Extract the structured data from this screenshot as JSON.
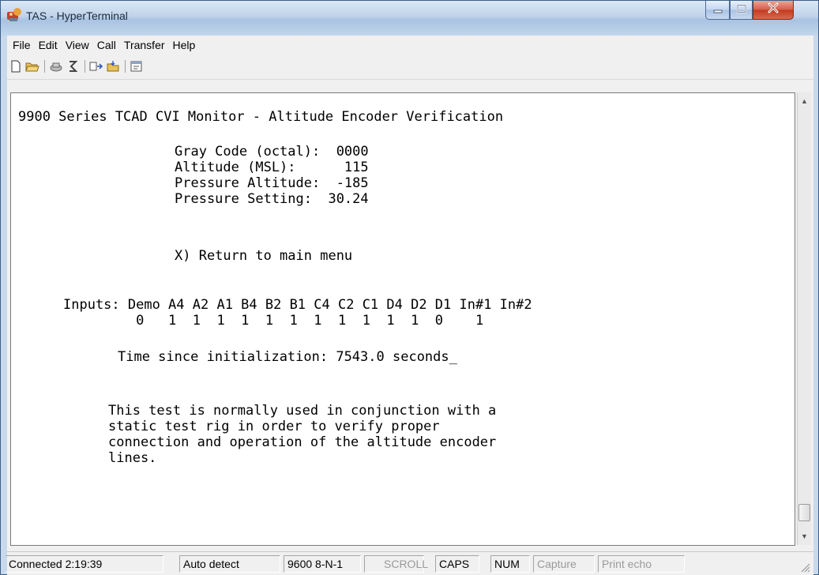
{
  "window": {
    "title": "TAS - HyperTerminal"
  },
  "menu": [
    "File",
    "Edit",
    "View",
    "Call",
    "Transfer",
    "Help"
  ],
  "toolbar": {
    "icons": [
      "new-connection-icon",
      "open-icon",
      "disconnect-icon",
      "dial-icon",
      "send-icon",
      "receive-icon",
      "properties-icon"
    ]
  },
  "terminal": {
    "header": "9900 Series TCAD CVI Monitor - Altitude Encoder Verification",
    "fields": [
      "Gray Code (octal):  0000",
      "Altitude (MSL):      115",
      "Pressure Altitude:  -185",
      "Pressure Setting:  30.24"
    ],
    "menu_option": "X) Return to main menu",
    "inputs_labels": "Inputs: Demo A4 A2 A1 B4 B2 B1 C4 C2 C1 D4 D2 D1 In#1 In#2",
    "inputs_values": "         0   1  1  1  1  1  1  1  1  1  1  1  0    1",
    "time_line": "Time since initialization: 7543.0 seconds_",
    "note": [
      "This test is normally used in conjunction with a",
      "static test rig in order to verify proper",
      "connection and operation of the altitude encoder",
      "lines."
    ]
  },
  "status": {
    "connected": "Connected 2:19:39",
    "detect": "Auto detect",
    "port": "9600 8-N-1",
    "scroll": "SCROLL",
    "caps": "CAPS",
    "num": "NUM",
    "capture": "Capture",
    "print_echo": "Print echo"
  },
  "colors": {
    "title_bar": "#bfd3ea",
    "close_button": "#c33a21",
    "terminal_bg": "#ffffff",
    "status_dim": "#9a9a9a"
  }
}
